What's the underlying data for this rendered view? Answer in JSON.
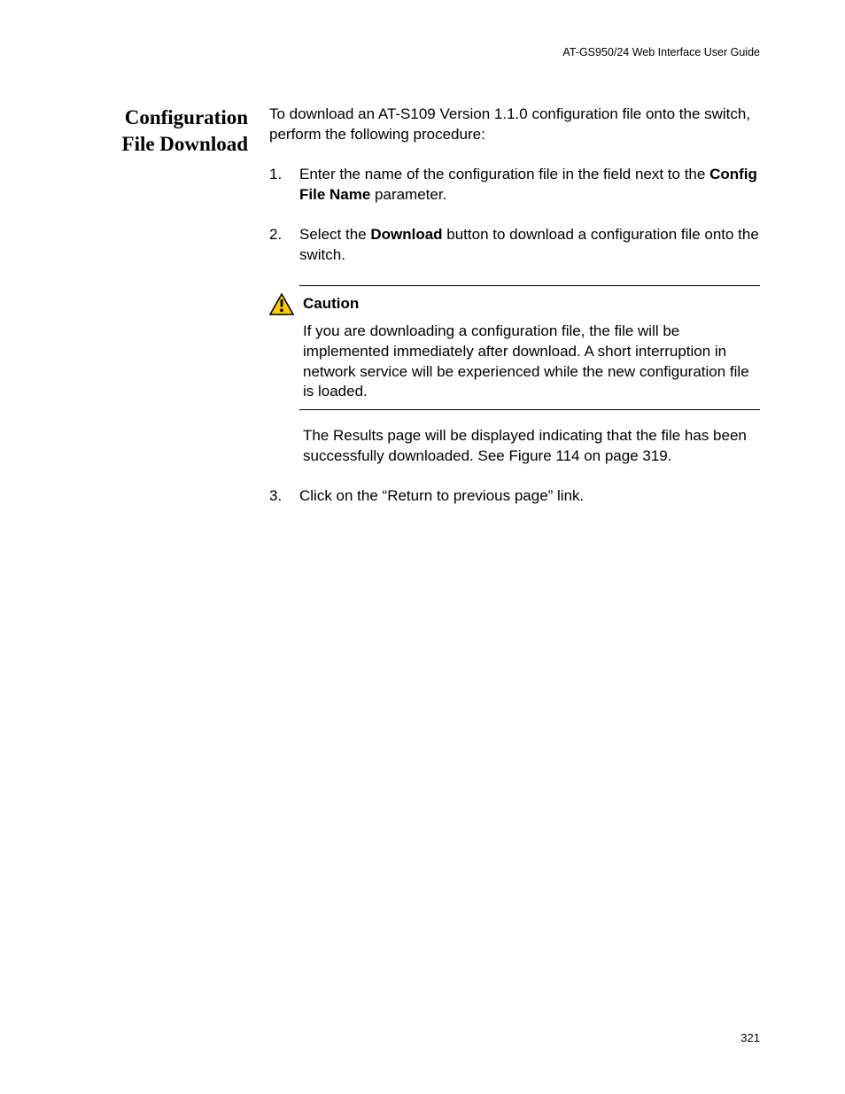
{
  "header": {
    "running_head": "AT-GS950/24  Web Interface User Guide"
  },
  "sideHeading": {
    "line1": "Configuration",
    "line2": "File Download"
  },
  "intro": "To download an AT-S109 Version 1.1.0  configuration file onto the switch, perform the following procedure:",
  "steps": {
    "s1": {
      "num": "1.",
      "text_a": "Enter the name of the configuration file in the field next to the ",
      "bold": "Config File Name",
      "text_b": " parameter."
    },
    "s2": {
      "num": "2.",
      "text_a": "Select the ",
      "bold": "Download",
      "text_b": " button to download a configuration file onto the switch."
    },
    "s3": {
      "num": "3.",
      "text": "Click on the “Return to previous page” link."
    }
  },
  "caution": {
    "label": "Caution",
    "body": "If you are downloading a configuration file, the file will be implemented immediately after download. A short interruption in network service will be experienced while the new configuration file is loaded."
  },
  "results": "The Results page will be displayed indicating that the file has been successfully downloaded. See Figure 114 on page 319.",
  "pageNumber": "321",
  "icons": {
    "caution": "caution-triangle-icon"
  }
}
